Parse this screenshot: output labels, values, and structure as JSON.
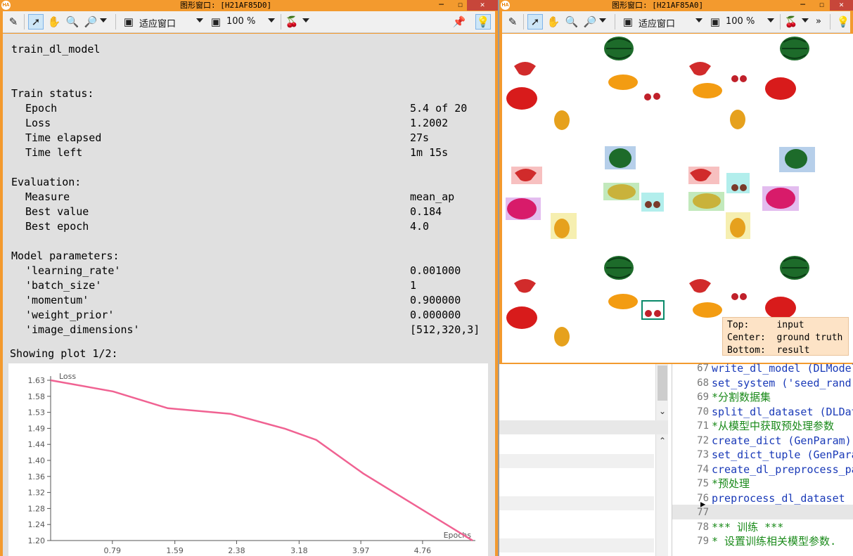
{
  "left_window": {
    "title": "图形窗口: [H21AF85D0]",
    "zoom_mode": "适应窗口",
    "zoom_percent": "100 %",
    "header": "train_dl_model",
    "sections": [
      {
        "heading": "Train status:",
        "rows": [
          {
            "label": "Epoch",
            "value": "5.4 of 20"
          },
          {
            "label": "Loss",
            "value": "1.2002"
          },
          {
            "label": "Time elapsed",
            "value": "27s"
          },
          {
            "label": "Time left",
            "value": "1m 15s"
          }
        ]
      },
      {
        "heading": "Evaluation:",
        "rows": [
          {
            "label": "Measure",
            "value": "mean_ap"
          },
          {
            "label": "Best value",
            "value": "0.184"
          },
          {
            "label": "Best epoch",
            "value": "4.0"
          }
        ]
      },
      {
        "heading": "Model parameters:",
        "rows": [
          {
            "label": "'learning_rate'",
            "value": "0.001000"
          },
          {
            "label": "'batch_size'",
            "value": "1"
          },
          {
            "label": "'momentum'",
            "value": "0.900000"
          },
          {
            "label": "'weight_prior'",
            "value": "0.000000"
          },
          {
            "label": "'image_dimensions'",
            "value": "[512,320,3]"
          }
        ]
      }
    ],
    "plot_caption": "Showing plot 1/2:"
  },
  "chart_data": {
    "type": "line",
    "ylabel": "Loss",
    "xlabel": "Epochs",
    "x_ticks": [
      "0.79",
      "1.59",
      "2.38",
      "3.18",
      "3.97",
      "4.76"
    ],
    "y_ticks": [
      "1.20",
      "1.24",
      "1.28",
      "1.32",
      "1.36",
      "1.40",
      "1.44",
      "1.49",
      "1.53",
      "1.58",
      "1.63"
    ],
    "xlim": [
      0.0,
      5.4
    ],
    "ylim": [
      1.2,
      1.63
    ],
    "x": [
      0.0,
      0.8,
      1.5,
      2.3,
      3.0,
      3.4,
      4.0,
      5.4
    ],
    "y": [
      1.63,
      1.6,
      1.555,
      1.54,
      1.5,
      1.47,
      1.38,
      1.2
    ],
    "line_color": "#f06292"
  },
  "right_window": {
    "title": "图形窗口: [H21AF85A0]",
    "zoom_mode": "适应窗口",
    "zoom_percent": "100 %",
    "more": "»",
    "legend": [
      {
        "key": "Top:",
        "value": "input"
      },
      {
        "key": "Center:",
        "value": "ground truth"
      },
      {
        "key": "Bottom:",
        "value": "result"
      }
    ]
  },
  "code_editor": {
    "lines": [
      {
        "n": "67",
        "text": "write_dl_model (DLModel",
        "kind": "op"
      },
      {
        "n": "68",
        "text": "set_system ('seed_rand'",
        "kind": "op"
      },
      {
        "n": "69",
        "text": "*分割数据集",
        "kind": "cm"
      },
      {
        "n": "70",
        "text": "split_dl_dataset (DLDat",
        "kind": "op"
      },
      {
        "n": "71",
        "text": "*从模型中获取预处理参数",
        "kind": "cm"
      },
      {
        "n": "72",
        "text": "create_dict (GenParam)",
        "kind": "op"
      },
      {
        "n": "73",
        "text": "set_dict_tuple (GenPara",
        "kind": "op"
      },
      {
        "n": "74",
        "text": "create_dl_preprocess_pa",
        "kind": "op"
      },
      {
        "n": "75",
        "text": "*预处理",
        "kind": "cm"
      },
      {
        "n": "76",
        "text": "preprocess_dl_dataset (",
        "kind": "op"
      },
      {
        "n": "77",
        "text": "",
        "kind": "op"
      },
      {
        "n": "78",
        "text": "*** 训练 ***",
        "kind": "cm"
      },
      {
        "n": "79",
        "text": "* 设置训练相关模型参数.",
        "kind": "cm"
      }
    ]
  }
}
